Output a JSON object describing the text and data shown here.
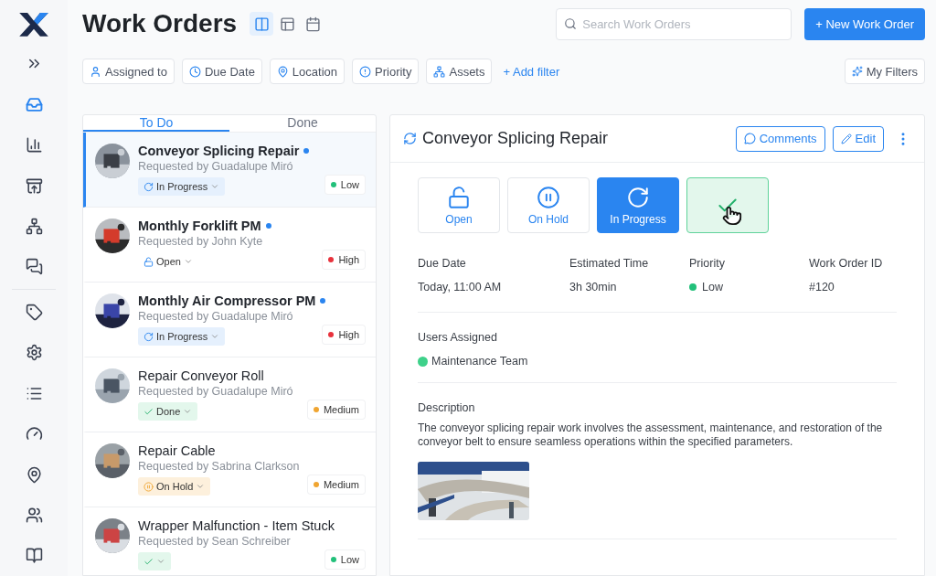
{
  "sidebar": {
    "items": [
      {
        "kind": "expand",
        "selected": false
      },
      {
        "kind": "inbox",
        "selected": true
      },
      {
        "kind": "chart",
        "selected": false
      },
      {
        "kind": "download",
        "selected": false
      },
      {
        "kind": "network",
        "selected": false
      },
      {
        "kind": "messages",
        "selected": false
      },
      {
        "kind": "divider"
      },
      {
        "kind": "tag",
        "selected": false
      },
      {
        "kind": "settings",
        "selected": false
      },
      {
        "kind": "list",
        "selected": false
      },
      {
        "kind": "gauge",
        "selected": false
      },
      {
        "kind": "pin",
        "selected": false
      },
      {
        "kind": "users",
        "selected": false
      },
      {
        "kind": "book",
        "selected": false
      }
    ]
  },
  "header": {
    "title": "Work Orders",
    "views": [
      {
        "kind": "columns",
        "selected": true
      },
      {
        "kind": "panels",
        "selected": false
      },
      {
        "kind": "calendar",
        "selected": false
      }
    ],
    "search": {
      "placeholder": "Search Work Orders"
    },
    "new_button": "+ New Work Order"
  },
  "filters": [
    {
      "kind": "user",
      "label": "Assigned to"
    },
    {
      "kind": "clock",
      "label": "Due Date"
    },
    {
      "kind": "pin",
      "label": "Location"
    },
    {
      "kind": "alert",
      "label": "Priority"
    },
    {
      "kind": "tree",
      "label": "Assets"
    }
  ],
  "add_filter": "+ Add filter",
  "my_filters": "My Filters",
  "list": {
    "tabs": [
      {
        "label": "To Do",
        "selected": true
      },
      {
        "label": "Done",
        "selected": false
      }
    ],
    "items": [
      {
        "title": "Conveyor Splicing Repair",
        "unread": true,
        "selected": true,
        "requester": "Requested by Guadalupe Miró",
        "status": {
          "kind": "progress",
          "label": "In Progress"
        },
        "priority": {
          "label": "Low",
          "color": "#22c07a"
        }
      },
      {
        "title": "Monthly Forklift PM",
        "unread": true,
        "selected": false,
        "requester": "Requested by John Kyte",
        "status": {
          "kind": "open",
          "label": "Open"
        },
        "priority": {
          "label": "High",
          "color": "#e8323c"
        }
      },
      {
        "title": "Monthly Air Compressor PM",
        "unread": true,
        "selected": false,
        "requester": "Requested by Guadalupe Miró",
        "status": {
          "kind": "progress",
          "label": "In Progress"
        },
        "priority": {
          "label": "High",
          "color": "#e8323c"
        }
      },
      {
        "title": "Repair Conveyor Roll",
        "unread": false,
        "selected": false,
        "requester": "Requested by Guadalupe Miró",
        "status": {
          "kind": "done",
          "label": "Done"
        },
        "priority": {
          "label": "Medium",
          "color": "#f0a531"
        }
      },
      {
        "title": "Repair Cable",
        "unread": false,
        "selected": false,
        "requester": "Requested by Sabrina Clarkson",
        "status": {
          "kind": "hold",
          "label": "On Hold"
        },
        "priority": {
          "label": "Medium",
          "color": "#f0a531"
        }
      },
      {
        "title": "Wrapper Malfunction - Item Stuck",
        "unread": false,
        "selected": false,
        "requester": "Requested by Sean Schreiber",
        "status": {
          "kind": "done"
        },
        "priority": {
          "label": "Low",
          "color": "#22c07a"
        }
      }
    ]
  },
  "detail": {
    "title": "Conveyor Splicing Repair",
    "comments": "Comments",
    "edit": "Edit",
    "statuses": [
      {
        "kind": "open",
        "label": "Open",
        "selected": false
      },
      {
        "kind": "hold",
        "label": "On Hold",
        "selected": false
      },
      {
        "kind": "progress",
        "label": "In Progress",
        "selected": true
      },
      {
        "kind": "done",
        "selected": false,
        "hovered": true
      }
    ],
    "fields": [
      {
        "label": "Due Date",
        "value": "Today, 11:00 AM"
      },
      {
        "label": "Estimated Time",
        "value": "3h 30min"
      },
      {
        "label": "Priority",
        "value": "Low",
        "color": "#22c07a"
      },
      {
        "label": "Work Order ID",
        "value": "#120"
      }
    ],
    "users_heading": "Users Assigned",
    "users": [
      "Maintenance Team"
    ],
    "description_heading": "Description",
    "description": "The conveyor splicing repair work involves the assessment, maintenance, and restoration of the conveyor belt to ensure seamless operations within the specified parameters.",
    "attachment": {
      "kind": "picture"
    }
  }
}
